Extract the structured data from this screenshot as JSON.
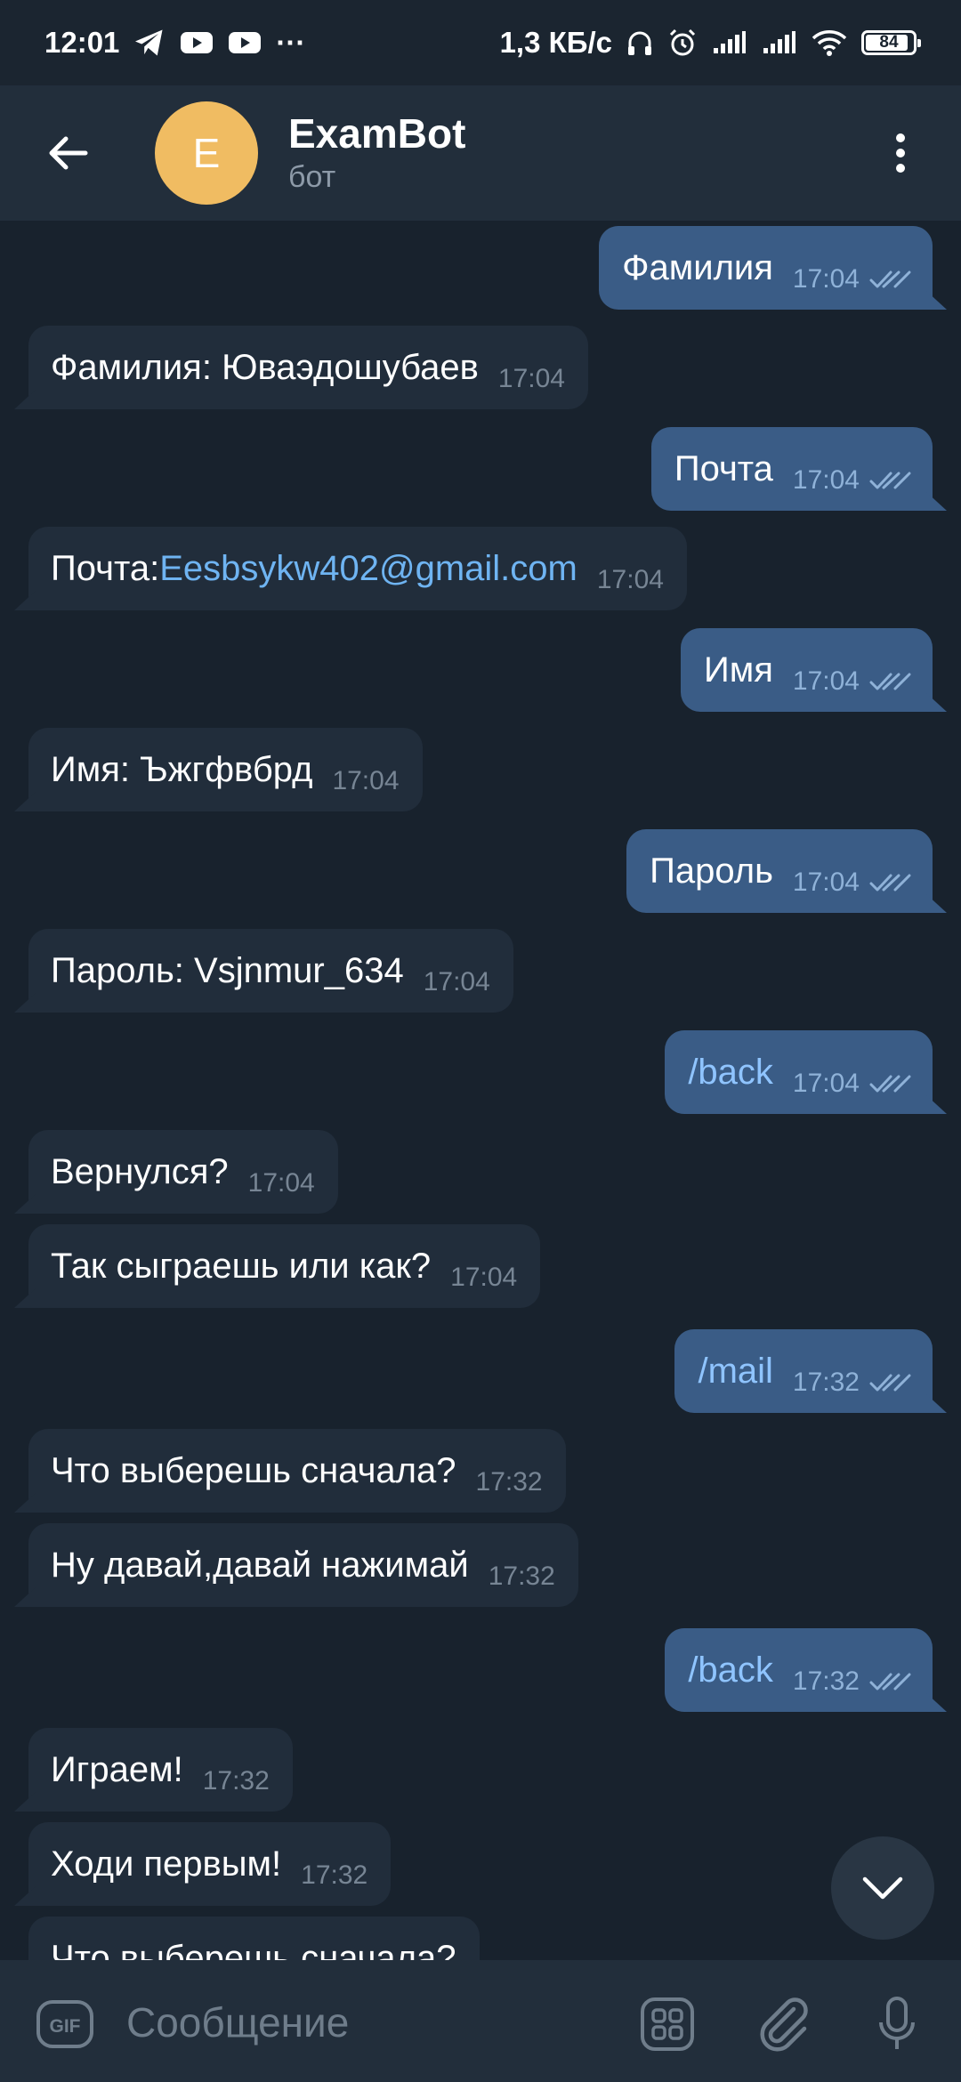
{
  "status_bar": {
    "time": "12:01",
    "more": "···",
    "speed": "1,3 КБ/с",
    "battery": "84",
    "icons": [
      "telegram-icon",
      "youtube-icon",
      "youtube-icon",
      "headphones-icon",
      "alarm-icon",
      "signal-icon",
      "signal-icon",
      "wifi-icon",
      "battery-icon"
    ]
  },
  "header": {
    "avatar_letter": "E",
    "title": "ExamBot",
    "subtitle": "бот"
  },
  "messages": [
    {
      "dir": "out",
      "text": "Фамилия",
      "time": "17:04"
    },
    {
      "dir": "in",
      "text": "Фамилия: Юваэдошубаев",
      "time": "17:04"
    },
    {
      "dir": "out",
      "text": "Почта",
      "time": "17:04"
    },
    {
      "dir": "in",
      "prefix": "Почта: ",
      "link": "Eesbsykw402@gmail.com",
      "time": "17:04"
    },
    {
      "dir": "out",
      "text": "Имя",
      "time": "17:04"
    },
    {
      "dir": "in",
      "text": "Имя: Ъжгфвбрд",
      "time": "17:04"
    },
    {
      "dir": "out",
      "text": "Пароль",
      "time": "17:04"
    },
    {
      "dir": "in",
      "text": "Пароль: Vsjnmur_634",
      "time": "17:04"
    },
    {
      "dir": "out",
      "text": "/back",
      "time": "17:04",
      "command": true
    },
    {
      "dir": "in",
      "text": "Вернулся?",
      "time": "17:04"
    },
    {
      "dir": "in",
      "text": "Так сыграешь или как?",
      "time": "17:04"
    },
    {
      "dir": "out",
      "text": "/mail",
      "time": "17:32",
      "command": true
    },
    {
      "dir": "in",
      "text": "Что выберешь сначала?",
      "time": "17:32"
    },
    {
      "dir": "in",
      "text": "Ну давай,давай нажимай",
      "time": "17:32"
    },
    {
      "dir": "out",
      "text": "/back",
      "time": "17:32",
      "command": true
    },
    {
      "dir": "in",
      "text": "Играем!",
      "time": "17:32"
    },
    {
      "dir": "in",
      "text": "Ходи первым!",
      "time": "17:32"
    },
    {
      "dir": "in",
      "text": "Что выберешь сначала?",
      "time": ""
    }
  ],
  "input": {
    "placeholder": "Сообщение",
    "gif_label": "GIF"
  },
  "colors": {
    "background": "#18222d",
    "header": "#222e3b",
    "incoming_bubble": "#212d3b",
    "outgoing_bubble": "#3a5c86",
    "avatar": "#f0bc62",
    "link": "#6fb4f2"
  }
}
